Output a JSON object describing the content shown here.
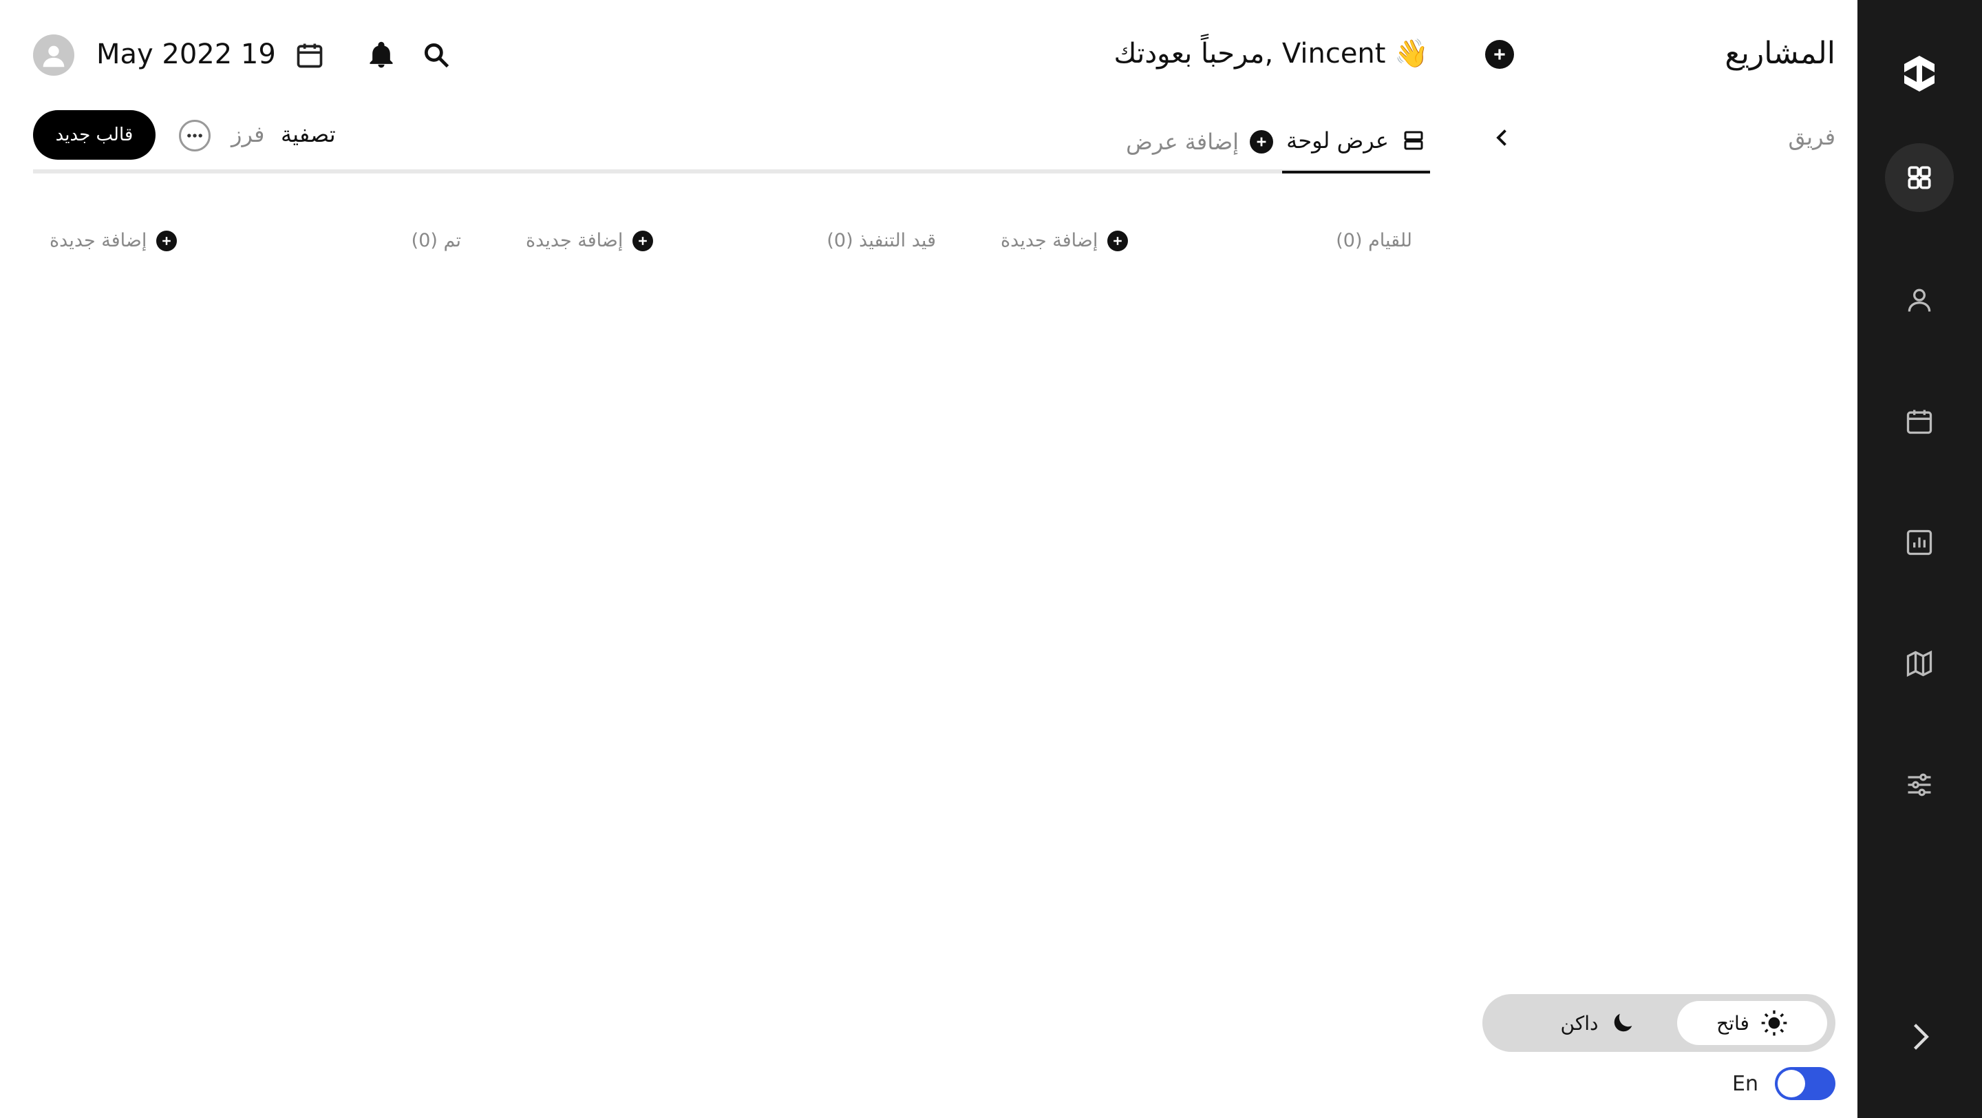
{
  "header": {
    "date": "May 2022 19",
    "welcome": "مرحباً بعودتك, Vincent 👋"
  },
  "sidebar_rail": {
    "items": [
      {
        "name": "dashboard",
        "icon": "grid-icon",
        "active": true
      },
      {
        "name": "people",
        "icon": "user-icon",
        "active": false
      },
      {
        "name": "calendar",
        "icon": "calendar-icon",
        "active": false
      },
      {
        "name": "reports",
        "icon": "chart-icon",
        "active": false
      },
      {
        "name": "map",
        "icon": "map-icon",
        "active": false
      },
      {
        "name": "settings",
        "icon": "sliders-icon",
        "active": false
      }
    ]
  },
  "projects": {
    "title": "المشاريع",
    "team_label": "فريق"
  },
  "tabs": {
    "board_view": "عرض لوحة",
    "add_view": "إضافة عرض"
  },
  "toolbar": {
    "filter": "تصفية",
    "sort": "فرز",
    "new_template": "قالب جديد"
  },
  "columns": [
    {
      "title": "للقيام (0)",
      "add_label": "إضافة جديدة"
    },
    {
      "title": "قيد التنفيذ (0)",
      "add_label": "إضافة جديدة"
    },
    {
      "title": "تم (0)",
      "add_label": "إضافة جديدة"
    }
  ],
  "theme": {
    "light": "فاتح",
    "dark": "داكن"
  },
  "language": {
    "label": "En"
  },
  "colors": {
    "rail_bg": "#1a1a1a",
    "accent": "#2f56e0",
    "primary": "#000000",
    "muted": "#888888"
  }
}
